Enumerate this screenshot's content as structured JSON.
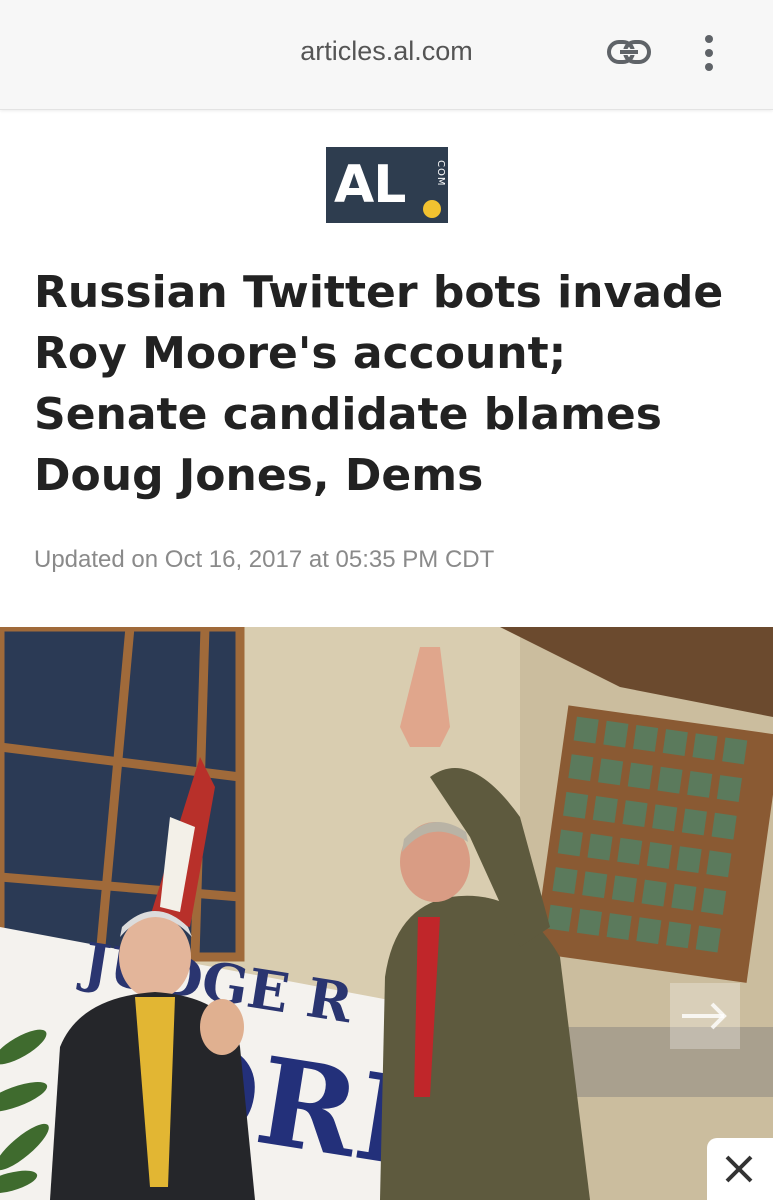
{
  "browser": {
    "url": "articles.al.com",
    "icons": [
      "link-icon",
      "more-vert-icon"
    ]
  },
  "logo": {
    "main": "AL",
    "sub": "COM",
    "dot_color": "#f2c230",
    "bg_color": "#2e3d4f"
  },
  "article": {
    "headline": "Russian Twitter bots invade Roy Moore's account; Senate candidate blames Doug Jones, Dems",
    "updated": "Updated on Oct 16, 2017 at 05:35 PM CDT"
  },
  "photo": {
    "sign_text_top": "JUDGE R",
    "sign_text_bottom": "ORE"
  },
  "controls": {
    "next_icon": "arrow-right-icon",
    "close_icon": "close-icon"
  }
}
